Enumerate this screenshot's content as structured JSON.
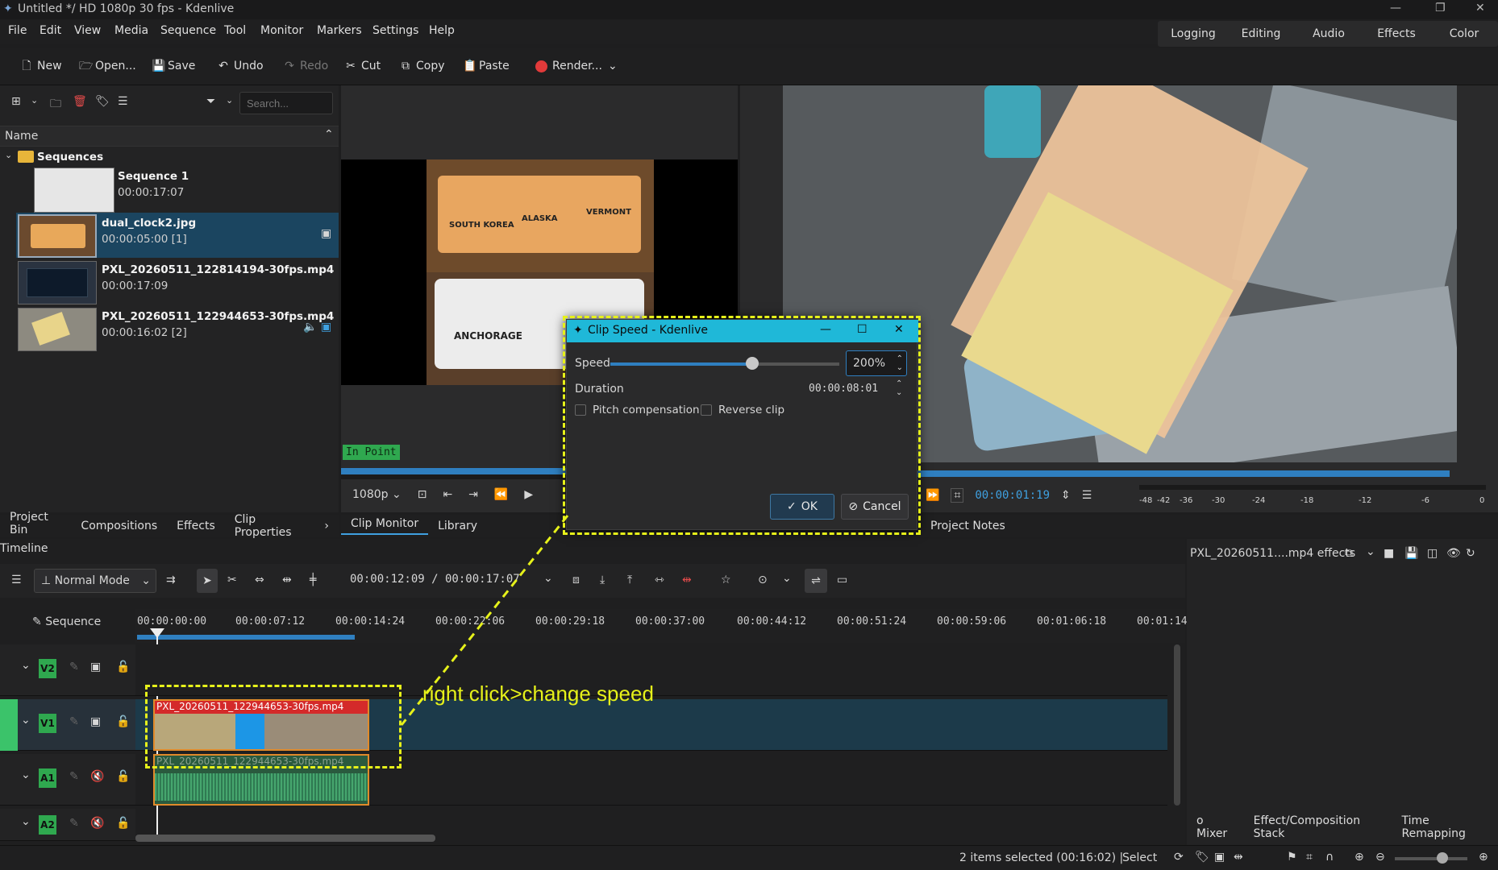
{
  "window": {
    "title": "Untitled */ HD 1080p 30 fps - Kdenlive"
  },
  "menu": [
    "File",
    "Edit",
    "View",
    "Media",
    "Sequence",
    "Tool",
    "Monitor",
    "Markers",
    "Settings",
    "Help"
  ],
  "workspaces": [
    "Logging",
    "Editing",
    "Audio",
    "Effects",
    "Color"
  ],
  "toolbar": {
    "new": "New",
    "open": "Open...",
    "save": "Save",
    "undo": "Undo",
    "redo": "Redo",
    "cut": "Cut",
    "copy": "Copy",
    "paste": "Paste",
    "render": "Render..."
  },
  "bin": {
    "search_placeholder": "Search...",
    "column_name": "Name",
    "folder": "Sequences",
    "clips": [
      {
        "name": "Sequence 1",
        "duration": "00:00:17:07"
      },
      {
        "name": "dual_clock2.jpg",
        "duration": "00:00:05:00 [1]"
      },
      {
        "name": "PXL_20260511_122814194-30fps.mp4",
        "duration": "00:00:17:09"
      },
      {
        "name": "PXL_20260511_122944653-30fps.mp4",
        "duration": "00:00:16:02 [2]"
      }
    ],
    "tabs": [
      "Project Bin",
      "Compositions",
      "Effects",
      "Clip Properties"
    ]
  },
  "clip_monitor": {
    "in_point": "In Point",
    "resolution": "1080p",
    "tabs": [
      "Clip Monitor",
      "Library"
    ],
    "clock_labels": [
      "SOUTH KOREA",
      "ALASKA",
      "VERMONT",
      "ANCHORAGE"
    ]
  },
  "project_monitor": {
    "timecode": "00:00:01:19",
    "tab": "Project Notes",
    "meter_labels": [
      "-48",
      "-42",
      "-36",
      "-30",
      "-24",
      "-18",
      "-12",
      "-6",
      "0"
    ]
  },
  "timeline": {
    "title": "Timeline",
    "mode": "Normal Mode",
    "position": "00:00:12:09 / 00:00:17:07",
    "sequence": "Sequence",
    "ruler": [
      "00:00:00:00",
      "00:00:07:12",
      "00:00:14:24",
      "00:00:22:06",
      "00:00:29:18",
      "00:00:37:00",
      "00:00:44:12",
      "00:00:51:24",
      "00:00:59:06",
      "00:01:06:18",
      "00:01:14:"
    ],
    "tracks": [
      "V2",
      "V1",
      "A1",
      "A2"
    ],
    "video_clip": "PXL_20260511_122944653-30fps.mp4",
    "audio_clip": "PXL_20260511_122944653-30fps.mp4"
  },
  "effects_panel": {
    "title": "PXL_20260511....mp4 effects",
    "tabs": [
      "o Mixer",
      "Effect/Composition Stack",
      "Time Remapping"
    ]
  },
  "status": {
    "selection": "2 items selected (00:16:02) |",
    "tool": "Select"
  },
  "dialog": {
    "title": "Clip Speed - Kdenlive",
    "speed_label": "Speed",
    "speed_value": "200%",
    "speed_fraction": 0.62,
    "duration_label": "Duration",
    "duration_value": "00:00:08:01",
    "pitch": "Pitch compensation",
    "reverse": "Reverse clip",
    "ok": "OK",
    "cancel": "Cancel"
  },
  "annotation": "right click>change speed",
  "colors": {
    "accent": "#1fb8d8",
    "highlight": "#e6f11a",
    "track_green": "#2fa84f",
    "clip_red": "#d42a2a"
  }
}
